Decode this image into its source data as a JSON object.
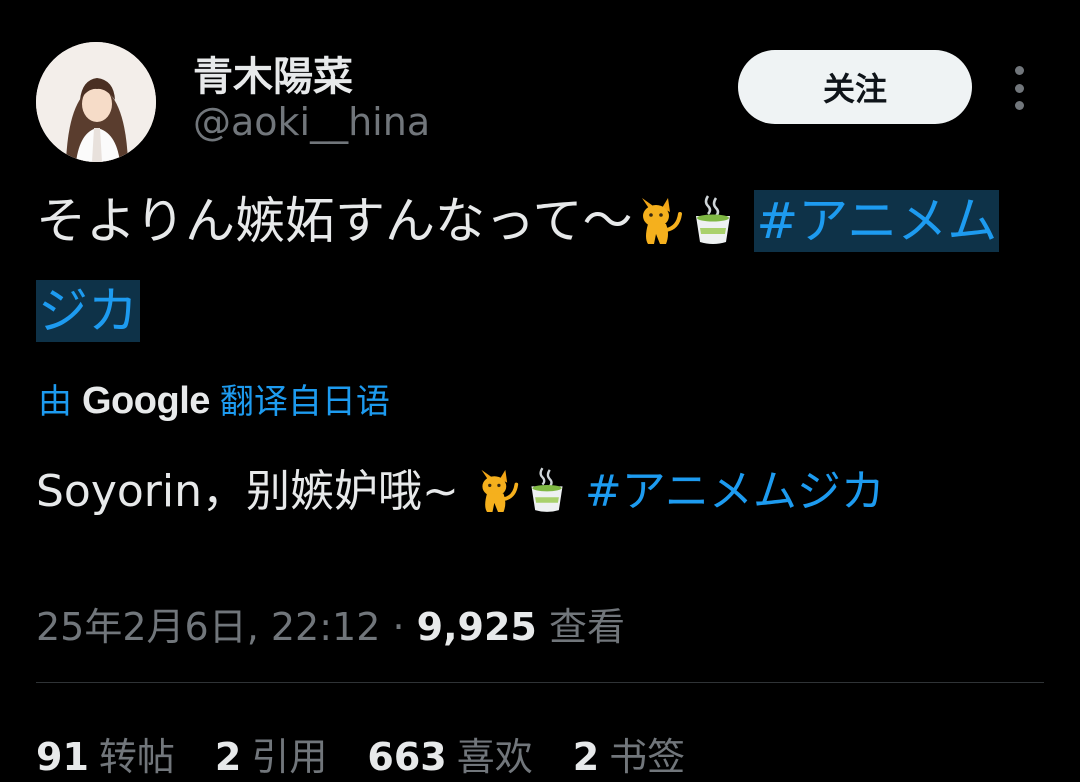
{
  "user": {
    "display_name": "青木陽菜",
    "handle": "@aoki__hina"
  },
  "actions": {
    "follow_label": "关注",
    "more_icon": "more-vertical-icon"
  },
  "tweet": {
    "text_main": "そよりん嫉妬すんなって〜",
    "hashtag": "#アニメムジカ",
    "emojis": [
      "cat-icon",
      "tea-icon"
    ]
  },
  "translation": {
    "prefix": "由",
    "provider": "Google",
    "suffix": "翻译自日语",
    "text": "Soyorin，别嫉妒哦~",
    "hashtag": "#アニメムジカ"
  },
  "meta": {
    "timestamp": "25年2月6日, 22:12",
    "separator": "·",
    "views_count": "9,925",
    "views_label": "查看"
  },
  "stats": [
    {
      "count": "91",
      "label": "转帖"
    },
    {
      "count": "2",
      "label": "引用"
    },
    {
      "count": "663",
      "label": "喜欢"
    },
    {
      "count": "2",
      "label": "书签"
    }
  ],
  "colors": {
    "accent": "#1d9bf0",
    "background": "#000000",
    "muted": "#71767b"
  }
}
